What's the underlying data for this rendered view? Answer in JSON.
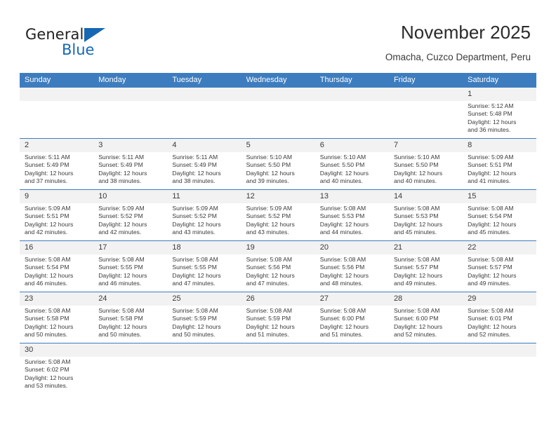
{
  "brand": {
    "name_part1": "General",
    "name_part2": "Blue",
    "accent_color": "#1668b3"
  },
  "header": {
    "title": "November 2025",
    "subtitle": "Omacha, Cuzco Department, Peru"
  },
  "theme": {
    "header_blue": "#3d7dbf",
    "daynum_band": "#f2f2f2",
    "text": "#3a3a3a"
  },
  "weekday_headers": [
    "Sunday",
    "Monday",
    "Tuesday",
    "Wednesday",
    "Thursday",
    "Friday",
    "Saturday"
  ],
  "weeks": [
    [
      {
        "day": "",
        "sunrise": "",
        "sunset": "",
        "daylight_line1": "",
        "daylight_line2": ""
      },
      {
        "day": "",
        "sunrise": "",
        "sunset": "",
        "daylight_line1": "",
        "daylight_line2": ""
      },
      {
        "day": "",
        "sunrise": "",
        "sunset": "",
        "daylight_line1": "",
        "daylight_line2": ""
      },
      {
        "day": "",
        "sunrise": "",
        "sunset": "",
        "daylight_line1": "",
        "daylight_line2": ""
      },
      {
        "day": "",
        "sunrise": "",
        "sunset": "",
        "daylight_line1": "",
        "daylight_line2": ""
      },
      {
        "day": "",
        "sunrise": "",
        "sunset": "",
        "daylight_line1": "",
        "daylight_line2": ""
      },
      {
        "day": "1",
        "sunrise": "Sunrise: 5:12 AM",
        "sunset": "Sunset: 5:48 PM",
        "daylight_line1": "Daylight: 12 hours",
        "daylight_line2": "and 36 minutes."
      }
    ],
    [
      {
        "day": "2",
        "sunrise": "Sunrise: 5:11 AM",
        "sunset": "Sunset: 5:49 PM",
        "daylight_line1": "Daylight: 12 hours",
        "daylight_line2": "and 37 minutes."
      },
      {
        "day": "3",
        "sunrise": "Sunrise: 5:11 AM",
        "sunset": "Sunset: 5:49 PM",
        "daylight_line1": "Daylight: 12 hours",
        "daylight_line2": "and 38 minutes."
      },
      {
        "day": "4",
        "sunrise": "Sunrise: 5:11 AM",
        "sunset": "Sunset: 5:49 PM",
        "daylight_line1": "Daylight: 12 hours",
        "daylight_line2": "and 38 minutes."
      },
      {
        "day": "5",
        "sunrise": "Sunrise: 5:10 AM",
        "sunset": "Sunset: 5:50 PM",
        "daylight_line1": "Daylight: 12 hours",
        "daylight_line2": "and 39 minutes."
      },
      {
        "day": "6",
        "sunrise": "Sunrise: 5:10 AM",
        "sunset": "Sunset: 5:50 PM",
        "daylight_line1": "Daylight: 12 hours",
        "daylight_line2": "and 40 minutes."
      },
      {
        "day": "7",
        "sunrise": "Sunrise: 5:10 AM",
        "sunset": "Sunset: 5:50 PM",
        "daylight_line1": "Daylight: 12 hours",
        "daylight_line2": "and 40 minutes."
      },
      {
        "day": "8",
        "sunrise": "Sunrise: 5:09 AM",
        "sunset": "Sunset: 5:51 PM",
        "daylight_line1": "Daylight: 12 hours",
        "daylight_line2": "and 41 minutes."
      }
    ],
    [
      {
        "day": "9",
        "sunrise": "Sunrise: 5:09 AM",
        "sunset": "Sunset: 5:51 PM",
        "daylight_line1": "Daylight: 12 hours",
        "daylight_line2": "and 42 minutes."
      },
      {
        "day": "10",
        "sunrise": "Sunrise: 5:09 AM",
        "sunset": "Sunset: 5:52 PM",
        "daylight_line1": "Daylight: 12 hours",
        "daylight_line2": "and 42 minutes."
      },
      {
        "day": "11",
        "sunrise": "Sunrise: 5:09 AM",
        "sunset": "Sunset: 5:52 PM",
        "daylight_line1": "Daylight: 12 hours",
        "daylight_line2": "and 43 minutes."
      },
      {
        "day": "12",
        "sunrise": "Sunrise: 5:09 AM",
        "sunset": "Sunset: 5:52 PM",
        "daylight_line1": "Daylight: 12 hours",
        "daylight_line2": "and 43 minutes."
      },
      {
        "day": "13",
        "sunrise": "Sunrise: 5:08 AM",
        "sunset": "Sunset: 5:53 PM",
        "daylight_line1": "Daylight: 12 hours",
        "daylight_line2": "and 44 minutes."
      },
      {
        "day": "14",
        "sunrise": "Sunrise: 5:08 AM",
        "sunset": "Sunset: 5:53 PM",
        "daylight_line1": "Daylight: 12 hours",
        "daylight_line2": "and 45 minutes."
      },
      {
        "day": "15",
        "sunrise": "Sunrise: 5:08 AM",
        "sunset": "Sunset: 5:54 PM",
        "daylight_line1": "Daylight: 12 hours",
        "daylight_line2": "and 45 minutes."
      }
    ],
    [
      {
        "day": "16",
        "sunrise": "Sunrise: 5:08 AM",
        "sunset": "Sunset: 5:54 PM",
        "daylight_line1": "Daylight: 12 hours",
        "daylight_line2": "and 46 minutes."
      },
      {
        "day": "17",
        "sunrise": "Sunrise: 5:08 AM",
        "sunset": "Sunset: 5:55 PM",
        "daylight_line1": "Daylight: 12 hours",
        "daylight_line2": "and 46 minutes."
      },
      {
        "day": "18",
        "sunrise": "Sunrise: 5:08 AM",
        "sunset": "Sunset: 5:55 PM",
        "daylight_line1": "Daylight: 12 hours",
        "daylight_line2": "and 47 minutes."
      },
      {
        "day": "19",
        "sunrise": "Sunrise: 5:08 AM",
        "sunset": "Sunset: 5:56 PM",
        "daylight_line1": "Daylight: 12 hours",
        "daylight_line2": "and 47 minutes."
      },
      {
        "day": "20",
        "sunrise": "Sunrise: 5:08 AM",
        "sunset": "Sunset: 5:56 PM",
        "daylight_line1": "Daylight: 12 hours",
        "daylight_line2": "and 48 minutes."
      },
      {
        "day": "21",
        "sunrise": "Sunrise: 5:08 AM",
        "sunset": "Sunset: 5:57 PM",
        "daylight_line1": "Daylight: 12 hours",
        "daylight_line2": "and 49 minutes."
      },
      {
        "day": "22",
        "sunrise": "Sunrise: 5:08 AM",
        "sunset": "Sunset: 5:57 PM",
        "daylight_line1": "Daylight: 12 hours",
        "daylight_line2": "and 49 minutes."
      }
    ],
    [
      {
        "day": "23",
        "sunrise": "Sunrise: 5:08 AM",
        "sunset": "Sunset: 5:58 PM",
        "daylight_line1": "Daylight: 12 hours",
        "daylight_line2": "and 50 minutes."
      },
      {
        "day": "24",
        "sunrise": "Sunrise: 5:08 AM",
        "sunset": "Sunset: 5:58 PM",
        "daylight_line1": "Daylight: 12 hours",
        "daylight_line2": "and 50 minutes."
      },
      {
        "day": "25",
        "sunrise": "Sunrise: 5:08 AM",
        "sunset": "Sunset: 5:59 PM",
        "daylight_line1": "Daylight: 12 hours",
        "daylight_line2": "and 50 minutes."
      },
      {
        "day": "26",
        "sunrise": "Sunrise: 5:08 AM",
        "sunset": "Sunset: 5:59 PM",
        "daylight_line1": "Daylight: 12 hours",
        "daylight_line2": "and 51 minutes."
      },
      {
        "day": "27",
        "sunrise": "Sunrise: 5:08 AM",
        "sunset": "Sunset: 6:00 PM",
        "daylight_line1": "Daylight: 12 hours",
        "daylight_line2": "and 51 minutes."
      },
      {
        "day": "28",
        "sunrise": "Sunrise: 5:08 AM",
        "sunset": "Sunset: 6:00 PM",
        "daylight_line1": "Daylight: 12 hours",
        "daylight_line2": "and 52 minutes."
      },
      {
        "day": "29",
        "sunrise": "Sunrise: 5:08 AM",
        "sunset": "Sunset: 6:01 PM",
        "daylight_line1": "Daylight: 12 hours",
        "daylight_line2": "and 52 minutes."
      }
    ],
    [
      {
        "day": "30",
        "sunrise": "Sunrise: 5:08 AM",
        "sunset": "Sunset: 6:02 PM",
        "daylight_line1": "Daylight: 12 hours",
        "daylight_line2": "and 53 minutes."
      },
      {
        "day": "",
        "sunrise": "",
        "sunset": "",
        "daylight_line1": "",
        "daylight_line2": ""
      },
      {
        "day": "",
        "sunrise": "",
        "sunset": "",
        "daylight_line1": "",
        "daylight_line2": ""
      },
      {
        "day": "",
        "sunrise": "",
        "sunset": "",
        "daylight_line1": "",
        "daylight_line2": ""
      },
      {
        "day": "",
        "sunrise": "",
        "sunset": "",
        "daylight_line1": "",
        "daylight_line2": ""
      },
      {
        "day": "",
        "sunrise": "",
        "sunset": "",
        "daylight_line1": "",
        "daylight_line2": ""
      },
      {
        "day": "",
        "sunrise": "",
        "sunset": "",
        "daylight_line1": "",
        "daylight_line2": ""
      }
    ]
  ]
}
